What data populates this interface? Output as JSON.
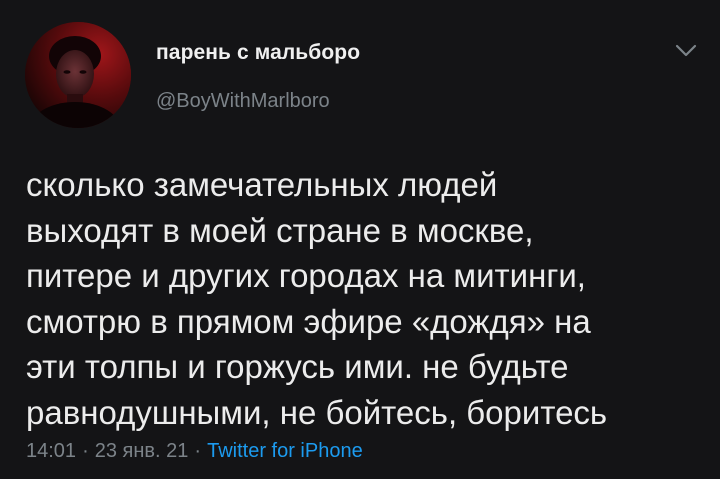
{
  "tweet": {
    "author": {
      "display_name": "парень с мальборо",
      "handle": "@BoyWithMarlboro"
    },
    "text": "сколько замечательных людей\nвыходят в моей стране в москве,\nпитере и других городах на митинги,\nсмотрю в прямом эфире «дождя» на\nэти толпы и горжусь ими. не будьте\nравнодушными, не бойтесь, боритесь",
    "time": "14:01",
    "date": "23 янв. 21",
    "source": "Twitter for iPhone",
    "separator": "·"
  },
  "icons": {
    "avatar": "avatar-photo",
    "menu": "chevron-down-icon"
  },
  "colors": {
    "background": "#141416",
    "text": "#ececec",
    "muted": "#7c8389",
    "link": "#1c9bef"
  }
}
